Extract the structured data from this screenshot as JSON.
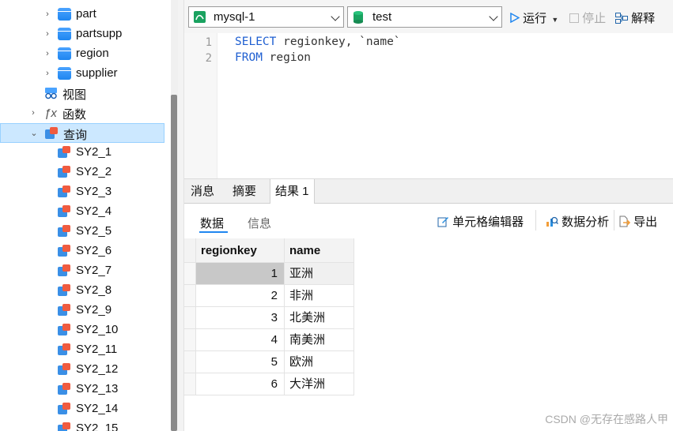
{
  "tree": {
    "tables": [
      "part",
      "partsupp",
      "region",
      "supplier"
    ],
    "views_label": "视图",
    "functions_label": "函数",
    "queries_label": "查询",
    "queries": [
      "SY2_1",
      "SY2_2",
      "SY2_3",
      "SY2_4",
      "SY2_5",
      "SY2_6",
      "SY2_7",
      "SY2_8",
      "SY2_9",
      "SY2_10",
      "SY2_11",
      "SY2_12",
      "SY2_13",
      "SY2_14",
      "SY2_15"
    ]
  },
  "toolbar": {
    "connection": "mysql-1",
    "database": "test",
    "run_label": "运行",
    "stop_label": "停止",
    "explain_label": "解释"
  },
  "editor": {
    "lines": [
      {
        "num": "1",
        "kw": "SELECT",
        "rest": " regionkey, `name`"
      },
      {
        "num": "2",
        "kw": "FROM",
        "rest": " region"
      }
    ]
  },
  "result_tabs": [
    "消息",
    "摘要",
    "结果 1"
  ],
  "sub_tabs": [
    "数据",
    "信息"
  ],
  "actions": {
    "cell_editor": "单元格编辑器",
    "data_analysis": "数据分析",
    "export": "导出"
  },
  "table": {
    "columns": [
      "regionkey",
      "name"
    ],
    "rows": [
      [
        "1",
        "亚洲"
      ],
      [
        "2",
        "非洲"
      ],
      [
        "3",
        "北美洲"
      ],
      [
        "4",
        "南美洲"
      ],
      [
        "5",
        "欧洲"
      ],
      [
        "6",
        "大洋洲"
      ]
    ]
  },
  "watermark": "CSDN @无存在感路人甲",
  "colors": {
    "accent": "#1f86f0",
    "keyword": "#1f5fd1",
    "selection": "#cce8ff"
  }
}
